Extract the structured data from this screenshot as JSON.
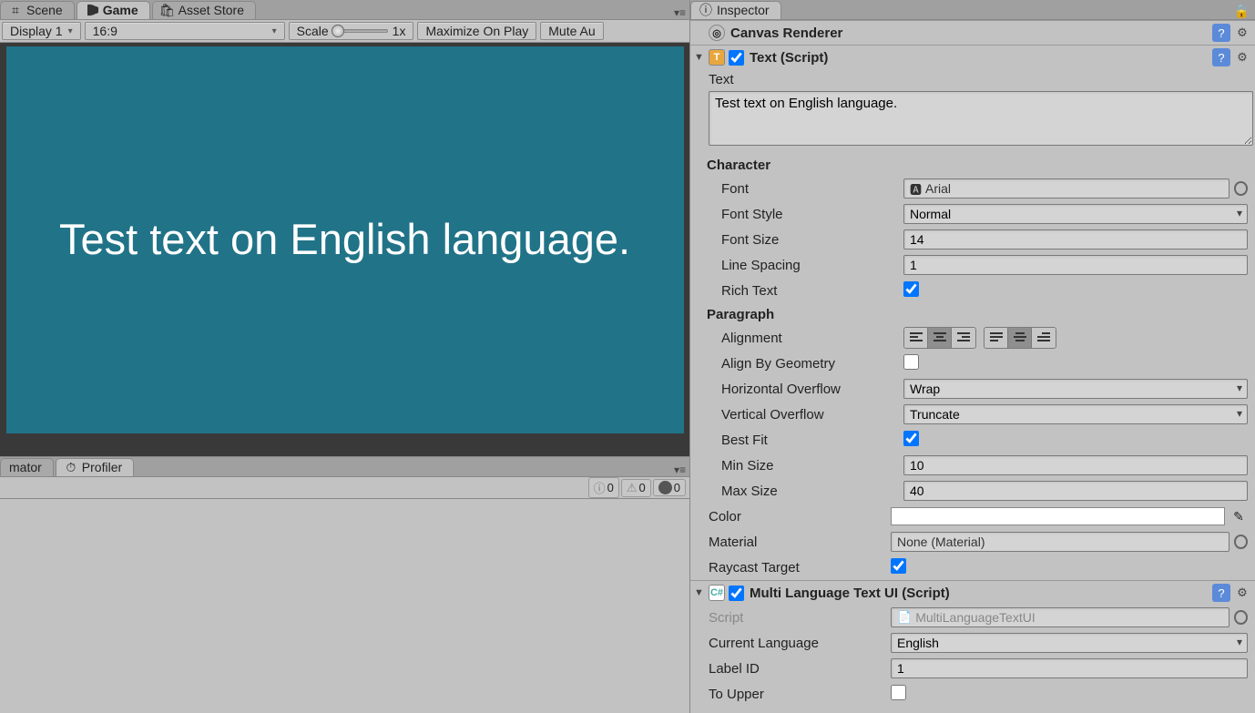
{
  "tabs": {
    "scene": "Scene",
    "game": "Game",
    "asset_store": "Asset Store"
  },
  "toolbar": {
    "display": "Display 1",
    "aspect": "16:9",
    "scale_label": "Scale",
    "scale_value": "1x",
    "maximize": "Maximize On Play",
    "mute": "Mute Au"
  },
  "game_view": {
    "text": "Test text on English language."
  },
  "lower_tabs": {
    "animator": "mator",
    "profiler": "Profiler"
  },
  "console": {
    "info_count": "0",
    "warn_count": "0",
    "error_count": "0"
  },
  "inspector": {
    "tab": "Inspector",
    "components": {
      "canvas_renderer": "Canvas Renderer",
      "text_script": {
        "title": "Text (Script)",
        "text_label": "Text",
        "text_value": "Test text on English language.",
        "character_section": "Character",
        "font_label": "Font",
        "font_value": "Arial",
        "font_style_label": "Font Style",
        "font_style_value": "Normal",
        "font_size_label": "Font Size",
        "font_size_value": "14",
        "line_spacing_label": "Line Spacing",
        "line_spacing_value": "1",
        "rich_text_label": "Rich Text",
        "rich_text_value": true,
        "paragraph_section": "Paragraph",
        "alignment_label": "Alignment",
        "align_by_geometry_label": "Align By Geometry",
        "align_by_geometry_value": false,
        "horizontal_overflow_label": "Horizontal Overflow",
        "horizontal_overflow_value": "Wrap",
        "vertical_overflow_label": "Vertical Overflow",
        "vertical_overflow_value": "Truncate",
        "best_fit_label": "Best Fit",
        "best_fit_value": true,
        "min_size_label": "Min Size",
        "min_size_value": "10",
        "max_size_label": "Max Size",
        "max_size_value": "40",
        "color_label": "Color",
        "material_label": "Material",
        "material_value": "None (Material)",
        "raycast_target_label": "Raycast Target",
        "raycast_target_value": true
      },
      "mlang": {
        "title": "Multi Language Text UI (Script)",
        "script_label": "Script",
        "script_value": "MultiLanguageTextUI",
        "current_language_label": "Current Language",
        "current_language_value": "English",
        "label_id_label": "Label ID",
        "label_id_value": "1",
        "to_upper_label": "To Upper",
        "to_upper_value": false
      }
    }
  }
}
